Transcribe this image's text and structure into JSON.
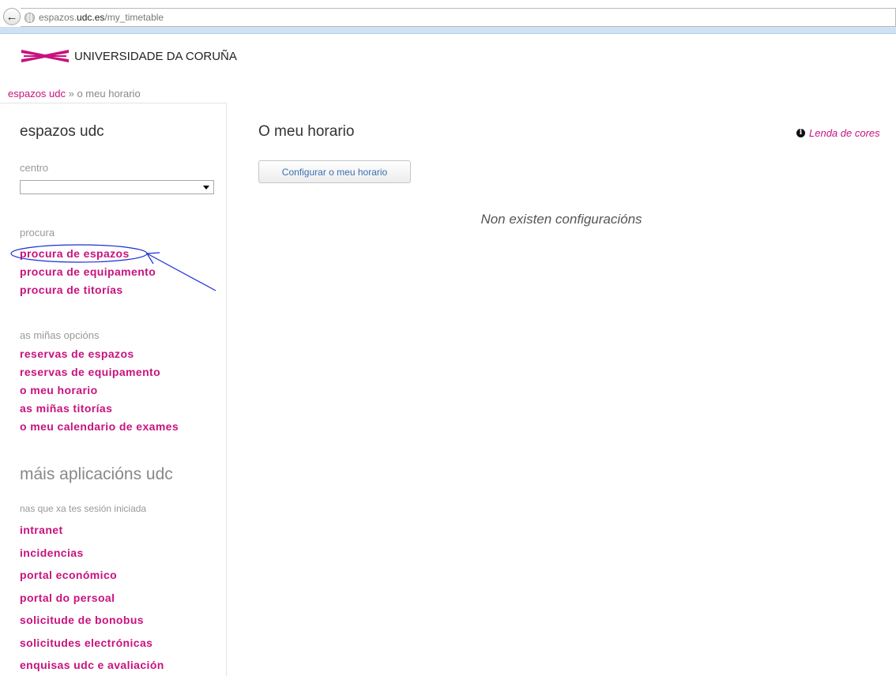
{
  "browser": {
    "url_prefix": "espazos.",
    "url_domain": "udc.es",
    "url_path": "/my_timetable"
  },
  "logo": {
    "text": "UNIVERSIDADE DA CORUÑA",
    "color": "#c8127e"
  },
  "breadcrumb": {
    "link": "espazos udc",
    "separator": " » ",
    "current": "o meu horario"
  },
  "sidebar": {
    "title": "espazos udc",
    "centro_label": "centro",
    "centro_value": "",
    "search_label": "procura",
    "search_links": [
      "procura de espazos",
      "procura de equipamento",
      "procura de titorías"
    ],
    "options_label": "as miñas opcións",
    "option_links": [
      "reservas de espazos",
      "reservas de equipamento",
      "o meu horario",
      "as miñas titorías",
      "o meu calendario de exames"
    ],
    "more_title": "máis aplicacións udc",
    "more_label": "nas que xa tes sesión iniciada",
    "app_links": [
      "intranet",
      "incidencias",
      "portal económico",
      "portal do persoal",
      "solicitude de bonobus",
      "solicitudes electrónicas",
      "enquisas udc e avaliación"
    ]
  },
  "main": {
    "title": "O meu horario",
    "legend_link": "Lenda de cores",
    "config_button": "Configurar o meu horario",
    "empty_message": "Non existen configuracións"
  },
  "colors": {
    "accent": "#c8127e",
    "annotation": "#1a2fd6",
    "button_text": "#3a6fb0"
  }
}
